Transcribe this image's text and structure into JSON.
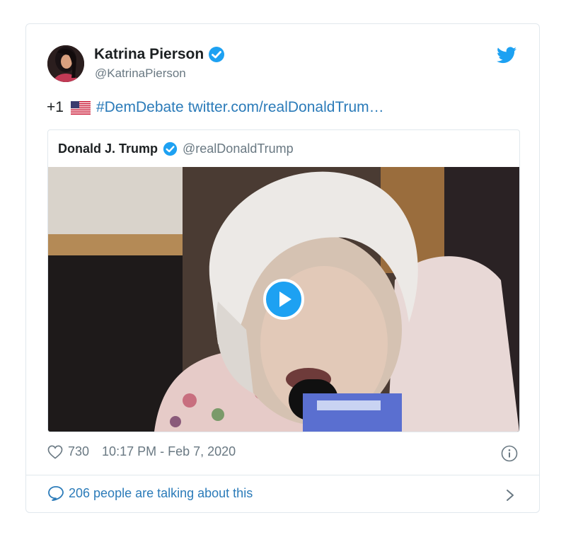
{
  "author": {
    "name": "Katrina Pierson",
    "handle": "@KatrinaPierson",
    "verified": true,
    "avatar_icon": "profile-photo"
  },
  "tweet": {
    "prefix": "+1",
    "flag_icon": "us-flag-emoji",
    "hashtag": "#DemDebate",
    "link": "twitter.com/realDonaldTrum…"
  },
  "quoted_tweet": {
    "name": "Donald J. Trump",
    "handle": "@realDonaldTrump",
    "verified": true,
    "media": {
      "type": "video",
      "play_icon": "play-icon"
    }
  },
  "meta": {
    "likes": "730",
    "timestamp": "10:17 PM - Feb 7, 2020"
  },
  "footer": {
    "talking_label": "206 people are talking about this"
  },
  "colors": {
    "accent": "#1da1f2",
    "link": "#2b7bb9",
    "secondary_text": "#697882",
    "border": "#e1e8ed"
  }
}
